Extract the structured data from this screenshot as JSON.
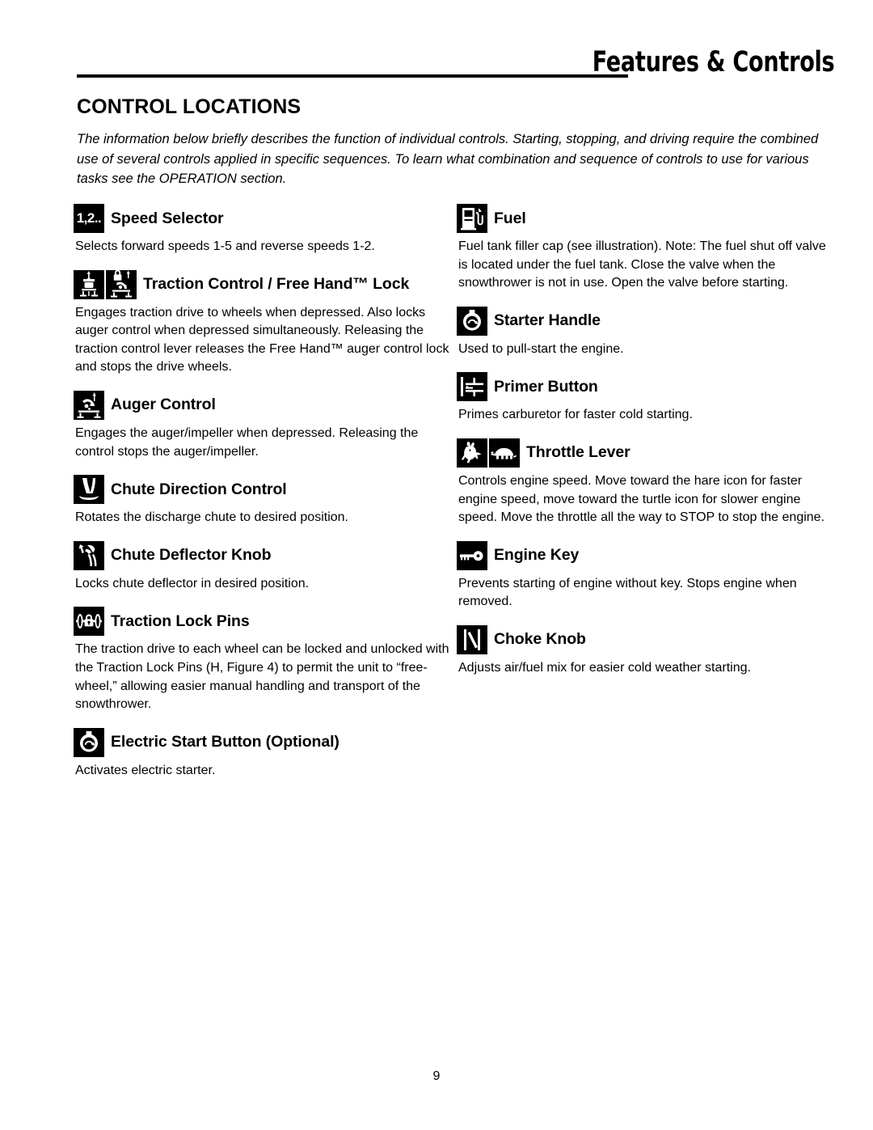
{
  "header": {
    "title": "Features & Controls"
  },
  "section": {
    "title": "CONTROL LOCATIONS",
    "intro": "The information below briefly describes the function of individual controls.  Starting, stopping, and driving require the combined use of several controls applied in specific sequences. To learn what combination and sequence of controls to use for various tasks see the OPERATION section."
  },
  "left_column": [
    {
      "icon": "speed-selector-icon",
      "icon_text": "1,2..",
      "title": "Speed Selector",
      "body": "Selects forward speeds 1-5 and reverse speeds 1-2."
    },
    {
      "icon": "traction-control-free-hand-lock-icon",
      "title": "Traction Control / Free Hand™ Lock",
      "body": "Engages traction drive to wheels when depressed.  Also locks auger control when depressed simultaneously. Releasing the traction control lever releases the Free Hand™ auger control lock and stops the drive wheels."
    },
    {
      "icon": "auger-control-icon",
      "title": "Auger Control",
      "body": "Engages the auger/impeller when depressed.  Releasing the control stops the auger/impeller."
    },
    {
      "icon": "chute-direction-control-icon",
      "title": "Chute Direction Control",
      "body": "Rotates the discharge chute to desired position."
    },
    {
      "icon": "chute-deflector-knob-icon",
      "title": "Chute Deflector Knob",
      "body": "Locks chute deflector in desired position."
    },
    {
      "icon": "traction-lock-pins-icon",
      "title": "Traction Lock Pins",
      "body": "The traction drive to each wheel can be locked and unlocked with the Traction Lock Pins (H, Figure 4) to permit the unit to “free-wheel,” allowing easier manual handling and transport of the snowthrower."
    },
    {
      "icon": "electric-start-button-icon",
      "title": "Electric Start Button (Optional)",
      "body": "Activates electric starter."
    }
  ],
  "right_column": [
    {
      "icon": "fuel-icon",
      "title": "Fuel",
      "body": "Fuel tank filler cap (see illustration).  Note: The fuel shut off valve is located under the fuel tank.  Close the valve when the snowthrower is not in use.  Open the valve before starting."
    },
    {
      "icon": "starter-handle-icon",
      "title": "Starter Handle",
      "body": "Used to pull-start the engine."
    },
    {
      "icon": "primer-button-icon",
      "title": "Primer Button",
      "body": "Primes carburetor for faster cold starting."
    },
    {
      "icon": "throttle-lever-icon",
      "title": "Throttle Lever",
      "body": "Controls engine speed.  Move toward the hare icon for faster engine speed, move toward the turtle icon for slower engine speed.  Move the throttle all the way to STOP to stop the engine."
    },
    {
      "icon": "engine-key-icon",
      "title": "Engine Key",
      "body": "Prevents starting of engine without key.  Stops engine when removed."
    },
    {
      "icon": "choke-knob-icon",
      "title": "Choke Knob",
      "body": "Adjusts air/fuel mix for easier cold weather starting."
    }
  ],
  "footer": {
    "page_number": "9"
  }
}
